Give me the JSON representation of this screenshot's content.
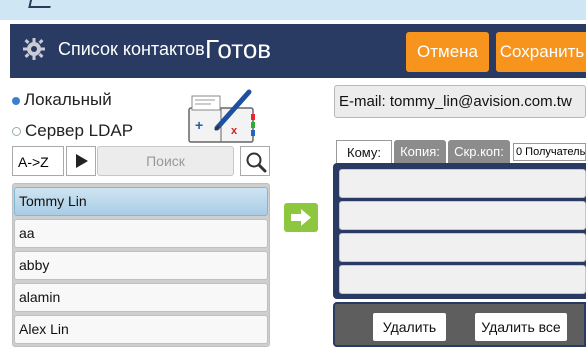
{
  "header": {
    "title": "Список контактов",
    "status": "Готов",
    "cancel_label": "Отмена",
    "save_label": "Сохранить",
    "bg_color": "#2a3b63",
    "button_color": "#f7941d"
  },
  "source": {
    "local_label": "Локальный",
    "ldap_label": "Сервер LDAP",
    "selected": "local"
  },
  "search": {
    "sort_label": "A->Z",
    "search_label": "Поиск"
  },
  "contacts": {
    "items": [
      "Tommy Lin",
      "aa",
      "abby",
      "alamin",
      "Alex Lin"
    ],
    "selected_index": 0
  },
  "email": {
    "text": "E-mail: tommy_lin@avision.com.tw"
  },
  "recipients": {
    "tabs": [
      "Кому:",
      "Копия:",
      "Скр.коп:"
    ],
    "count_label": "0 Получатель"
  },
  "actions": {
    "delete_label": "Удалить",
    "delete_all_label": "Удалить все"
  },
  "icons": {
    "title_icon": "gear-icon",
    "book_icon": "address-book-icon",
    "search_icon": "magnifier-icon",
    "play_icon": "play-icon",
    "add_icon": "arrow-right-icon"
  }
}
